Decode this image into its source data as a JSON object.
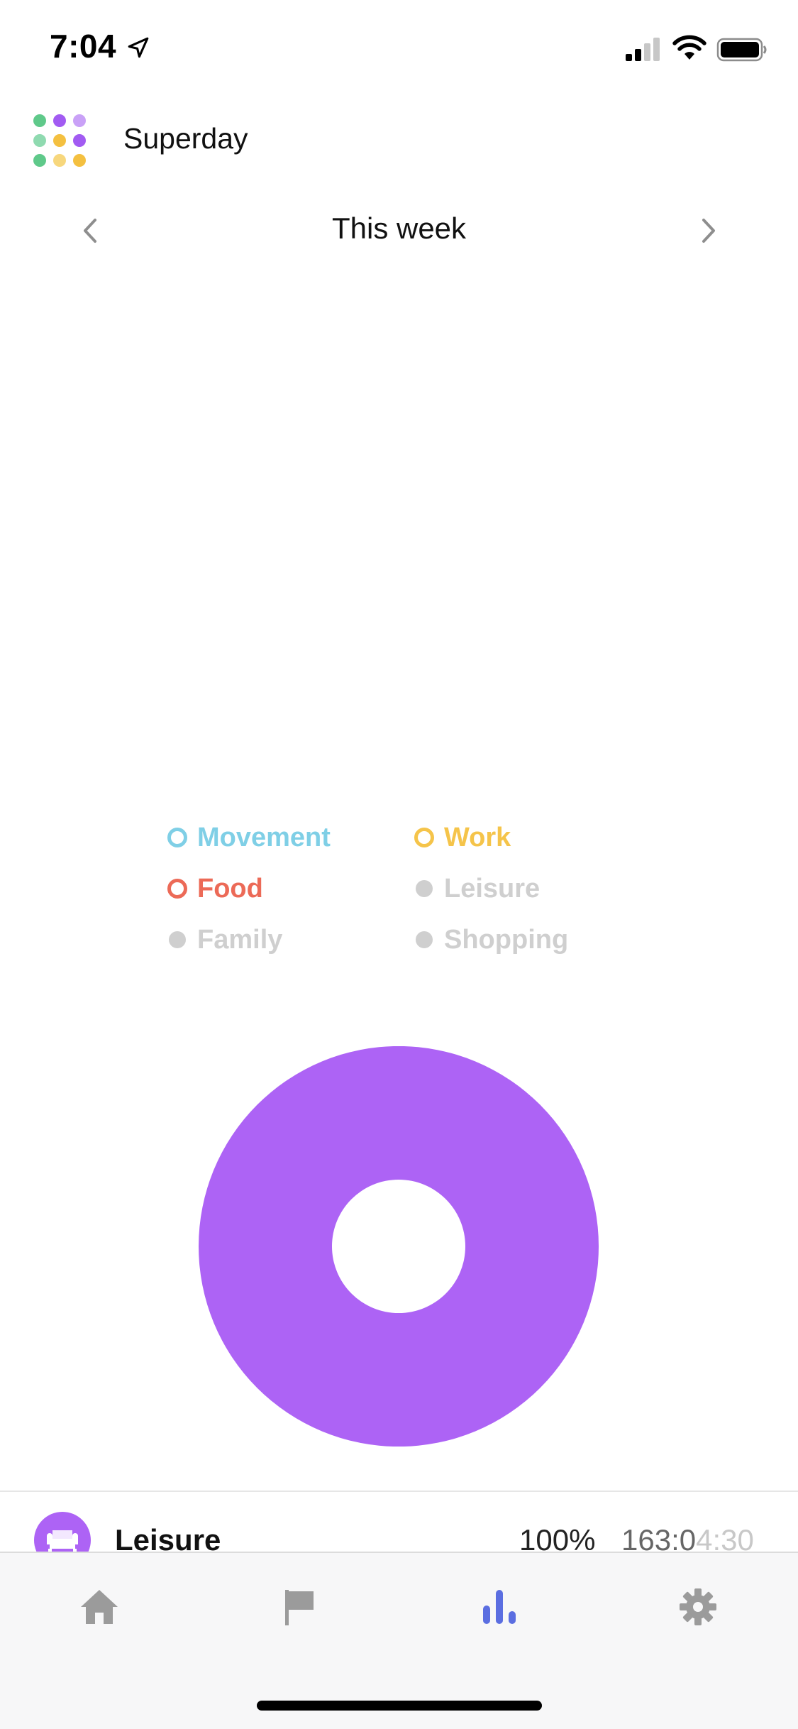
{
  "status_bar": {
    "time": "7:04"
  },
  "header": {
    "app_title": "Superday"
  },
  "week_nav": {
    "title": "This week"
  },
  "legend": [
    {
      "label": "Movement",
      "color": "#7fcfe6",
      "style": "ring"
    },
    {
      "label": "Work",
      "color": "#f5c44a",
      "style": "ring"
    },
    {
      "label": "Food",
      "color": "#ec6a57",
      "style": "ring"
    },
    {
      "label": "Leisure",
      "color": "#cfcfcf",
      "style": "dot"
    },
    {
      "label": "Family",
      "color": "#cfcfcf",
      "style": "dot"
    },
    {
      "label": "Shopping",
      "color": "#cfcfcf",
      "style": "dot"
    }
  ],
  "chart_data": {
    "type": "pie",
    "slices": [
      {
        "category": "Leisure",
        "value": 100,
        "color": "#ad63f5"
      }
    ]
  },
  "category_row": {
    "name": "Leisure",
    "percent": "100%",
    "time_main": "163:0",
    "time_faded": "4:30",
    "icon": "sofa-icon"
  },
  "tab_bar": [
    {
      "icon": "home-icon",
      "active": false
    },
    {
      "icon": "flag-icon",
      "active": false
    },
    {
      "icon": "chart-icon",
      "active": true
    },
    {
      "icon": "gear-icon",
      "active": false
    }
  ],
  "colors": {
    "accent": "#5b6ee1",
    "inactive_tab": "#9b9b9b",
    "leisure": "#ad63f5"
  }
}
